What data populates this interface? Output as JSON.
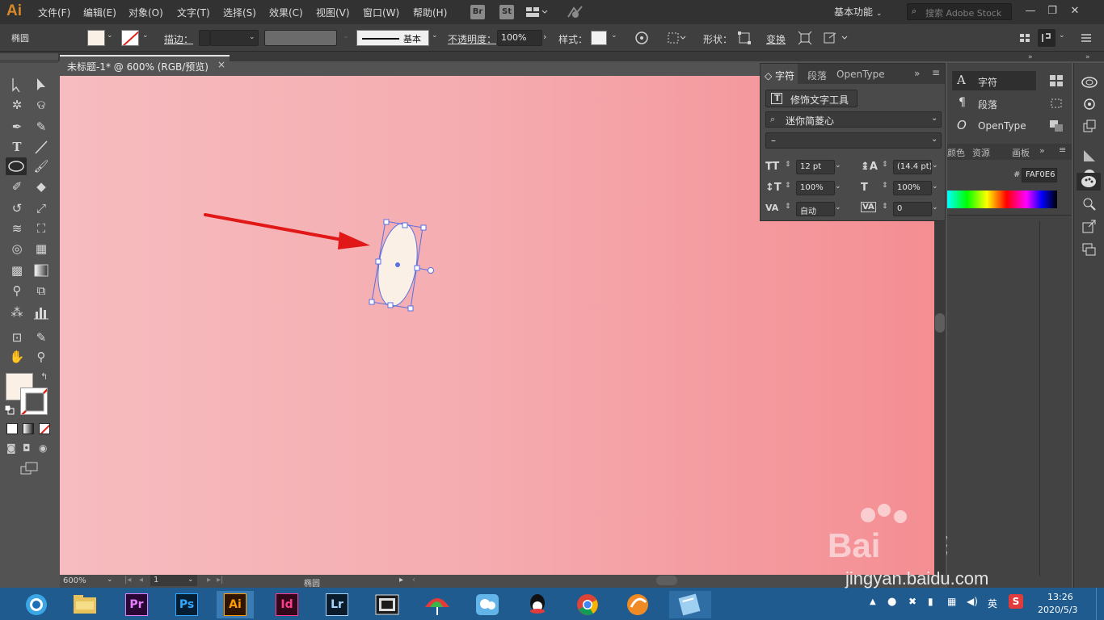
{
  "app": {
    "logo": "Ai",
    "accent": "#d88a2a"
  },
  "menu": [
    "文件(F)",
    "编辑(E)",
    "对象(O)",
    "文字(T)",
    "选择(S)",
    "效果(C)",
    "视图(V)",
    "窗口(W)",
    "帮助(H)"
  ],
  "top_badges": [
    "Br",
    "St"
  ],
  "workspace": {
    "label": "基本功能"
  },
  "search": {
    "placeholder": "搜索 Adobe Stock"
  },
  "control_bar": {
    "object_type": "椭圆",
    "stroke_label": "描边：",
    "stroke_style": "基本",
    "opacity_label": "不透明度：",
    "opacity_value": "100%",
    "style_label": "样式：",
    "shape_label": "形状：",
    "transform_label": "变换",
    "fill_color": "#FAF0E6"
  },
  "document": {
    "tab_label": "未标题-1* @ 600% (RGB/预览)",
    "close": "×"
  },
  "status_bar": {
    "zoom": "600%",
    "page": "1",
    "tool_name": "椭圆"
  },
  "character_panel": {
    "tabs": [
      "字符",
      "段落",
      "OpenType"
    ],
    "touch_tool": "修饰文字工具",
    "font_family": "迷你简菱心",
    "font_style": "–",
    "font_size": "12 pt",
    "leading": "(14.4 pt)",
    "vertical_scale": "100%",
    "horizontal_scale": "100%",
    "kerning": "自动",
    "tracking": "0"
  },
  "dock_panels": {
    "items": [
      "字符",
      "段落",
      "OpenType"
    ],
    "swatch_tabs": [
      "颜色",
      "资源",
      "画板"
    ],
    "hex_label": "#",
    "hex_value": "FAF0E6"
  },
  "taskbar": {
    "apps": [
      "Pr",
      "Ps",
      "Ai",
      "Id",
      "Lr"
    ],
    "ime": "英",
    "time": "13:26",
    "date": "2020/5/3"
  },
  "watermark": {
    "brand": "Bai",
    "suffix": "经验",
    "url": "jingyan.baidu.com"
  }
}
